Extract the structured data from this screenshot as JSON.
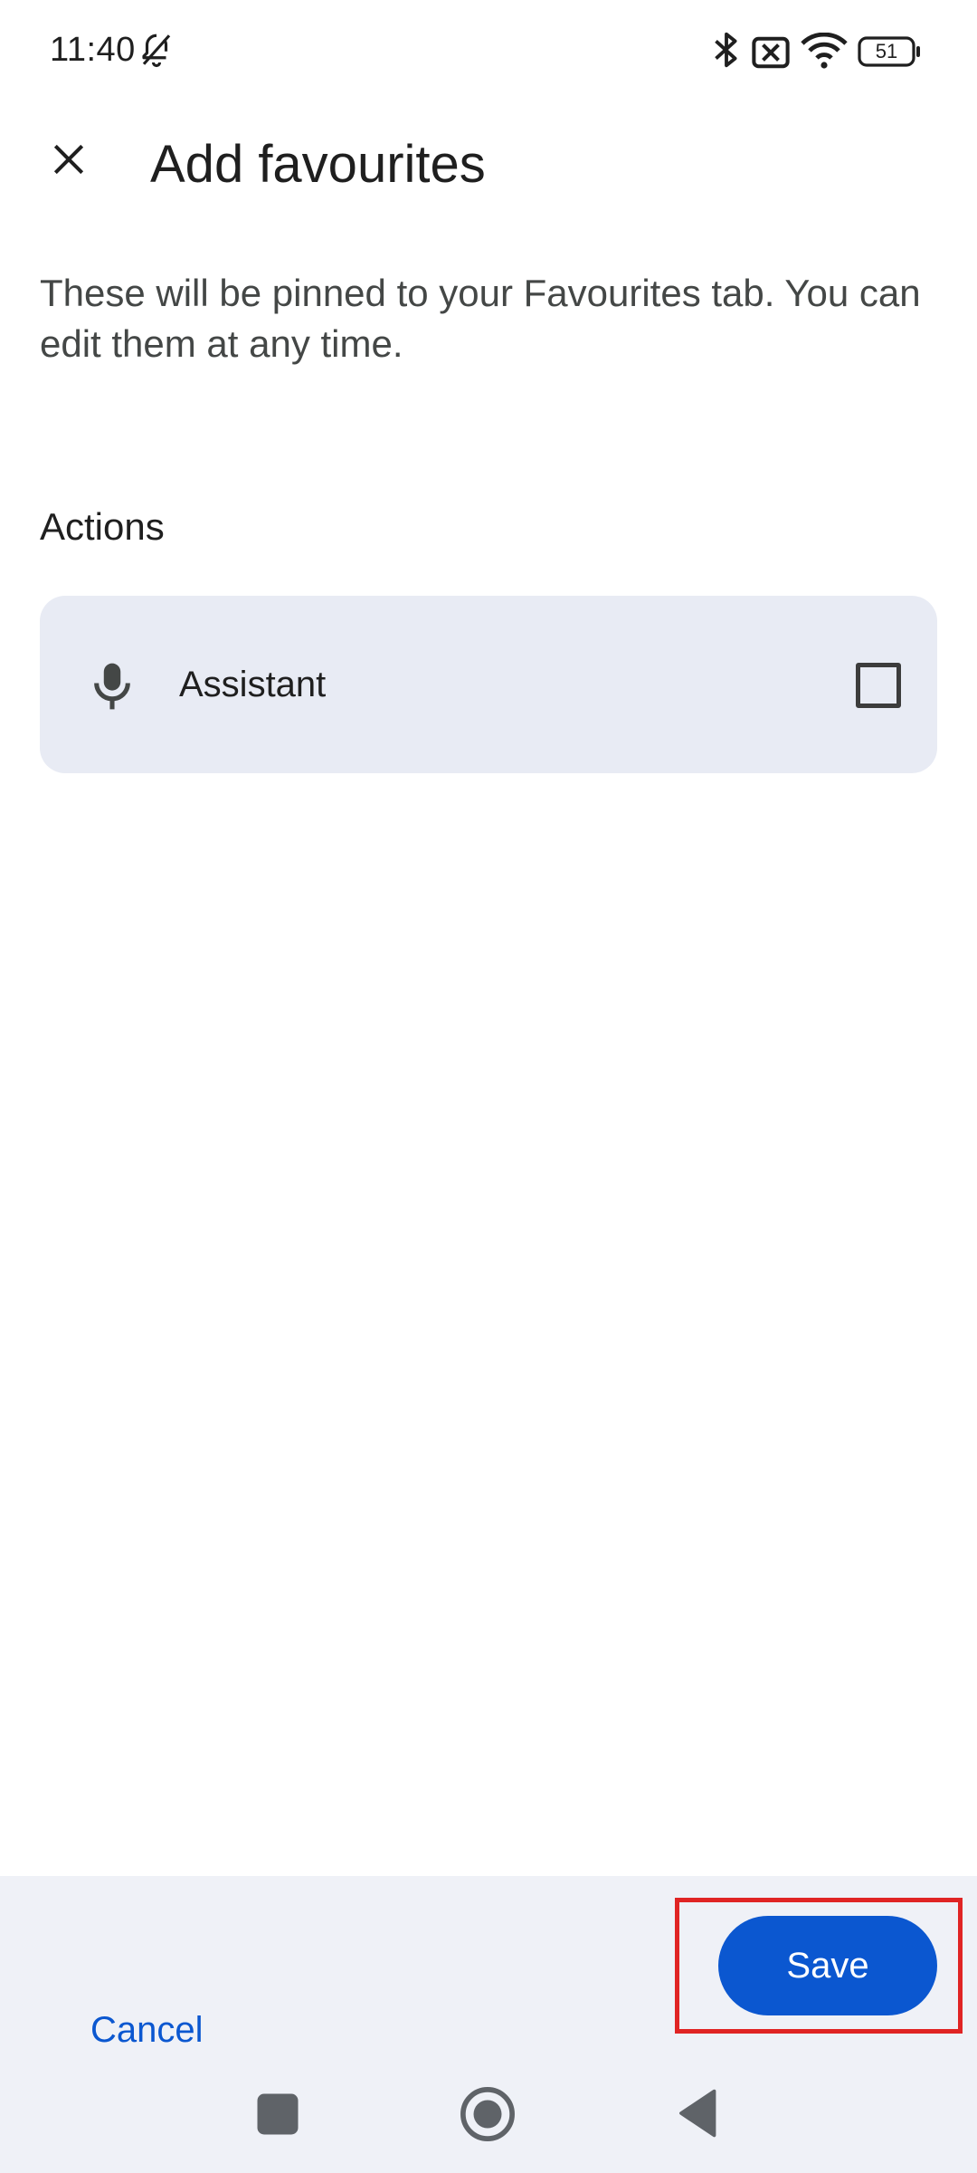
{
  "status_bar": {
    "time": "11:40",
    "battery_level": "51",
    "icons": [
      "bell-off-icon",
      "bluetooth-icon",
      "no-sim-icon",
      "wifi-icon",
      "battery-icon"
    ]
  },
  "header": {
    "title": "Add favourites",
    "close_icon": "close-icon"
  },
  "description": "These will be pinned to your Favourites tab. You can edit them at any time.",
  "section": {
    "heading": "Actions",
    "items": [
      {
        "icon": "microphone-icon",
        "label": "Assistant",
        "checked": false
      }
    ]
  },
  "footer": {
    "cancel_label": "Cancel",
    "save_label": "Save"
  },
  "nav_bar": {
    "icons": [
      "recents-square-icon",
      "home-circle-icon",
      "back-triangle-icon"
    ]
  },
  "colors": {
    "accent": "#0b57d0",
    "card_background": "#e8ebf4",
    "footer_background": "#eff1f7",
    "highlight_border": "#e02424"
  }
}
